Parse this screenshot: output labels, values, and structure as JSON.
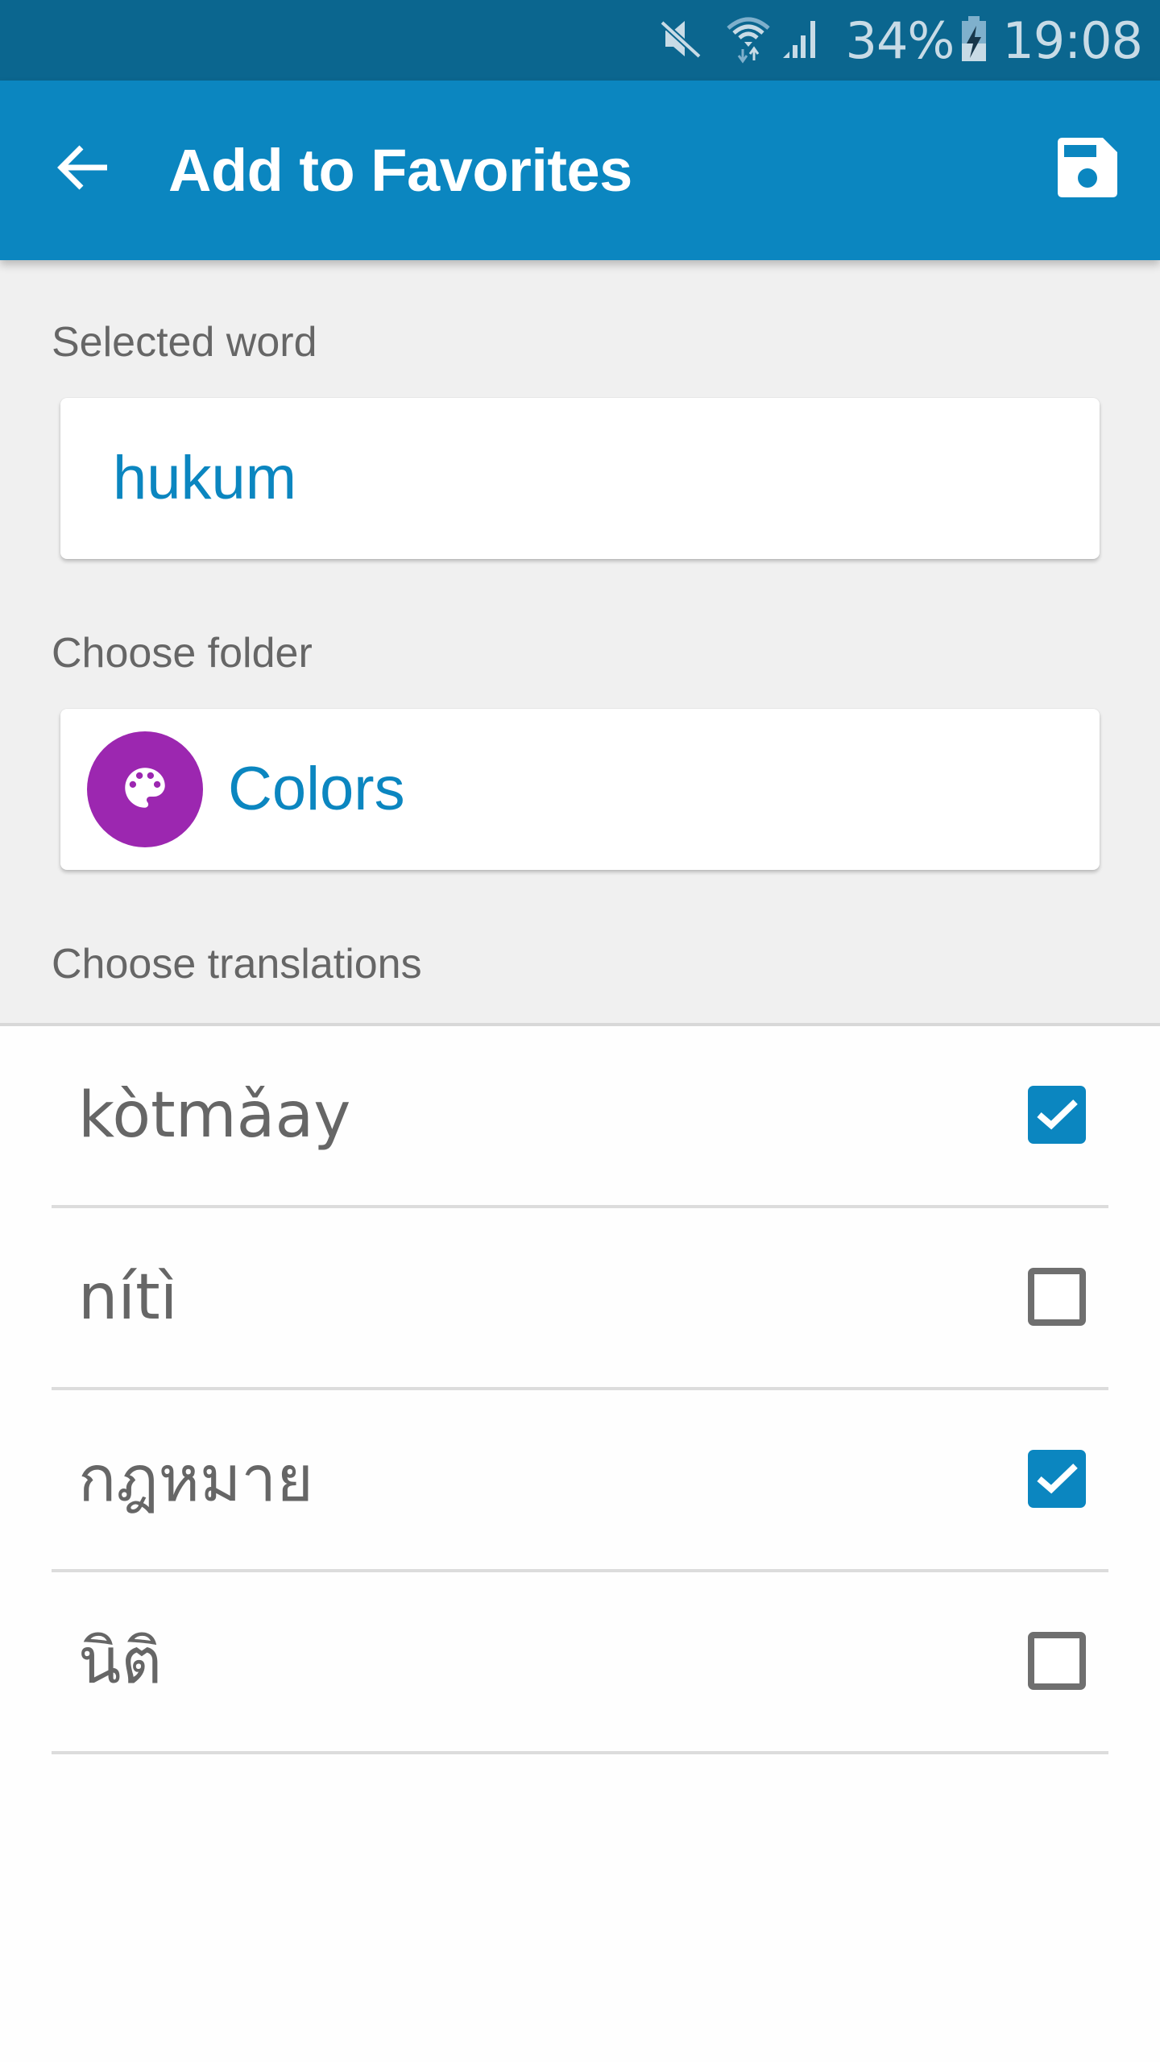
{
  "status_bar": {
    "battery_percent": "34%",
    "time": "19:08",
    "icons": [
      "mute-icon",
      "wifi-icon",
      "signal-icon",
      "battery-charging-icon"
    ]
  },
  "toolbar": {
    "back_icon": "arrow-back-icon",
    "title": "Add to Favorites",
    "save_icon": "save-floppy-icon"
  },
  "selected_word": {
    "label": "Selected word",
    "value": "hukum"
  },
  "folder": {
    "label": "Choose folder",
    "name": "Colors",
    "icon": "palette-icon",
    "icon_color": "#9c27b0"
  },
  "translations": {
    "label": "Choose translations",
    "items": [
      {
        "text": "kòtmǎay",
        "checked": true
      },
      {
        "text": "nítì",
        "checked": false
      },
      {
        "text": "กฎหมาย",
        "checked": true
      },
      {
        "text": "นิติ",
        "checked": false
      }
    ]
  },
  "colors": {
    "status_bar": "#0b668f",
    "primary": "#0b86c0",
    "background": "#f0f0f0"
  }
}
